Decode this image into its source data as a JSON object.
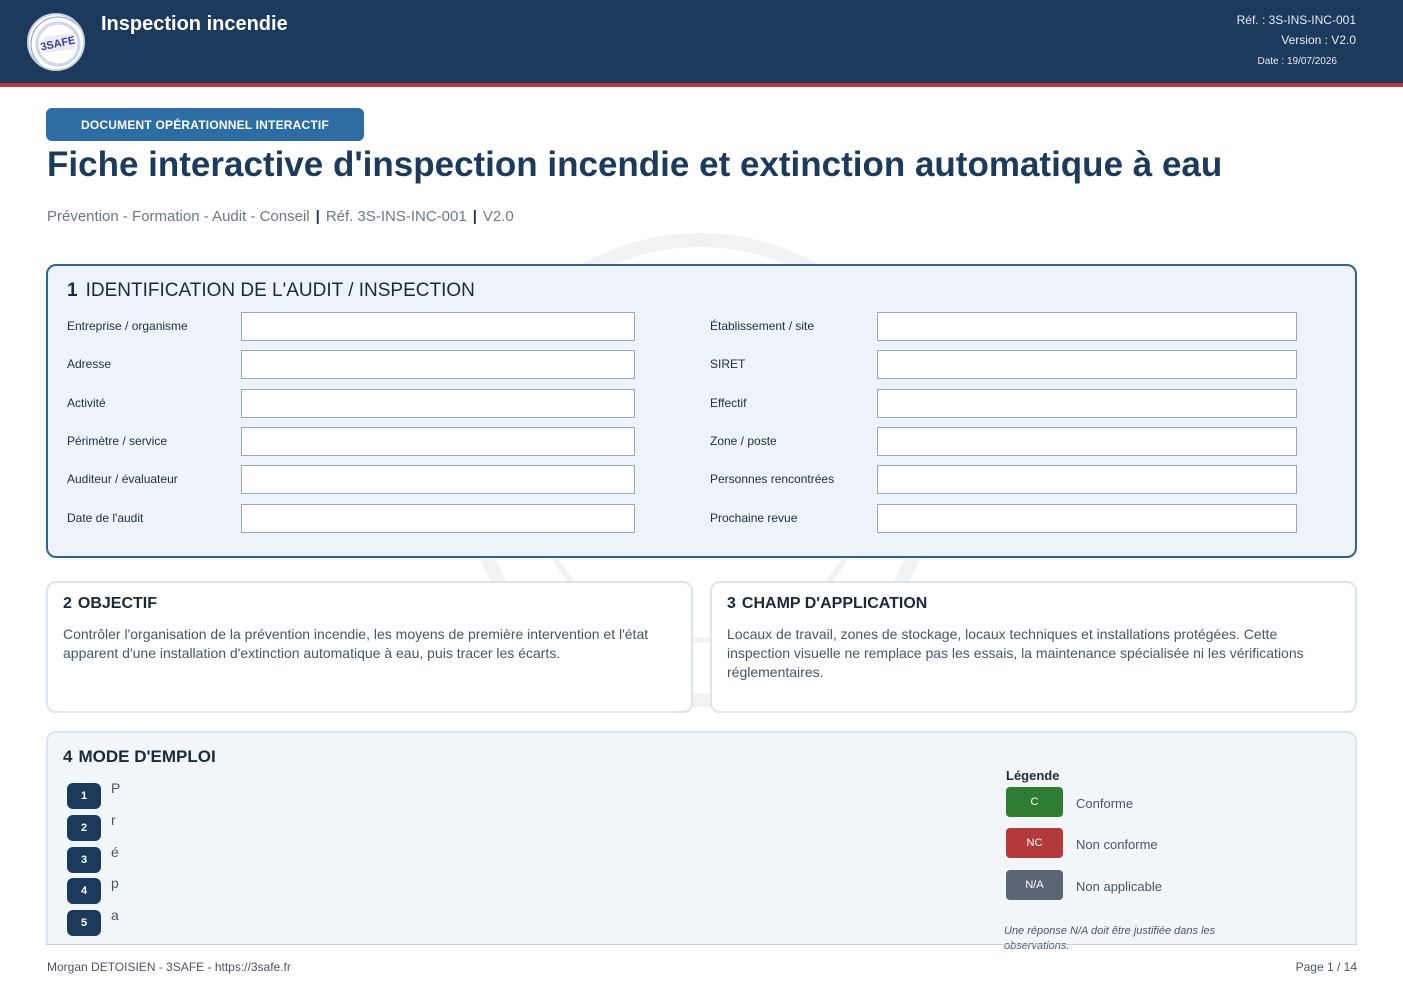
{
  "header": {
    "logo_text": "3SAFE",
    "app_title": "Inspection incendie",
    "ref": "Réf. : 3S-INS-INC-001",
    "version": "Version : V2.0",
    "date": "Date : 19/07/2026"
  },
  "doc": {
    "badge": "DOCUMENT OPÉRATIONNEL INTERACTIF",
    "title": "Fiche interactive d'inspection incendie et extinction automatique à eau",
    "subtitle_parts": [
      "Prévention - Formation - Audit - Conseil",
      "Réf. 3S-INS-INC-001",
      "V2.0"
    ],
    "separator": "|"
  },
  "section1": {
    "number": "1",
    "title": "IDENTIFICATION DE L'AUDIT / INSPECTION",
    "left_fields": [
      {
        "label": "Entreprise / organisme",
        "value": ""
      },
      {
        "label": "Adresse",
        "value": ""
      },
      {
        "label": "Activité",
        "value": ""
      },
      {
        "label": "Périmètre / service",
        "value": ""
      },
      {
        "label": "Auditeur / évaluateur",
        "value": ""
      },
      {
        "label": "Date de l'audit",
        "value": ""
      }
    ],
    "right_fields": [
      {
        "label": "Établissement / site",
        "value": ""
      },
      {
        "label": "SIRET",
        "value": ""
      },
      {
        "label": "Effectif",
        "value": ""
      },
      {
        "label": "Zone / poste",
        "value": ""
      },
      {
        "label": "Personnes rencontrées",
        "value": ""
      },
      {
        "label": "Prochaine revue",
        "value": ""
      }
    ]
  },
  "section2": {
    "number": "2",
    "title": "OBJECTIF",
    "text": "Contrôler l'organisation de la prévention incendie, les moyens de première intervention et l'état apparent d'une installation d'extinction automatique à eau, puis tracer les écarts."
  },
  "section3": {
    "number": "3",
    "title": "CHAMP D'APPLICATION",
    "text": "Locaux de travail, zones de stockage, locaux techniques et installations protégées. Cette inspection visuelle ne remplace pas les essais, la maintenance spécialisée ni les vérifications réglementaires."
  },
  "section4": {
    "number": "4",
    "title": "MODE D'EMPLOI",
    "steps": [
      {
        "num": "1",
        "text": "P"
      },
      {
        "num": "2",
        "text": "r"
      },
      {
        "num": "3",
        "text": "é"
      },
      {
        "num": "4",
        "text": "p"
      },
      {
        "num": "5",
        "text": "a"
      }
    ],
    "legend": {
      "title": "Légende",
      "items": [
        {
          "code": "C",
          "label": "Conforme",
          "color": "#2e7d32"
        },
        {
          "code": "NC",
          "label": "Non conforme",
          "color": "#b23a3a"
        },
        {
          "code": "N/A",
          "label": "Non applicable",
          "color": "#5c6672"
        }
      ],
      "note": "Une réponse N/A doit être justifiée dans les observations."
    }
  },
  "footer": {
    "left": "Morgan DETOISIEN - 3SAFE - https://3safe.fr",
    "right": "Page 1 / 14"
  },
  "colors": {
    "header_bg": "#1b3a5c",
    "accent_red": "#b23a3a",
    "badge_blue": "#2e6da4"
  }
}
